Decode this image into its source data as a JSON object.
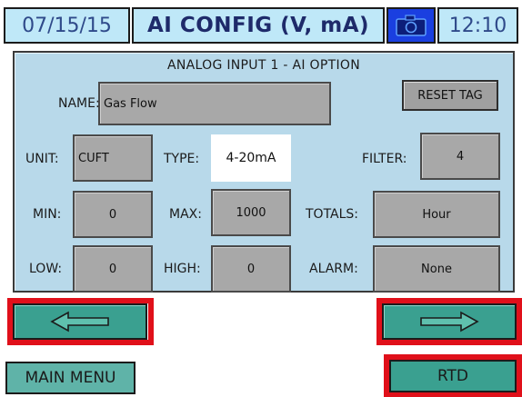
{
  "header": {
    "date": "07/15/15",
    "title": "AI CONFIG (V, mA)",
    "time": "12:10",
    "camera_icon": "camera-icon"
  },
  "panel": {
    "title": "ANALOG INPUT 1 - AI OPTION",
    "name_label": "NAME:",
    "name_value": "Gas Flow",
    "reset_label": "RESET TAG",
    "unit_label": "UNIT:",
    "unit_value": "CUFT",
    "type_label": "TYPE:",
    "type_value": "4-20mA",
    "filter_label": "FILTER:",
    "filter_value": "4",
    "min_label": "MIN:",
    "min_value": "0",
    "max_label": "MAX:",
    "max_value": "1000",
    "totals_label": "TOTALS:",
    "totals_value": "Hour",
    "low_label": "LOW:",
    "low_value": "0",
    "high_label": "HIGH:",
    "high_value": "0",
    "alarm_label": "ALARM:",
    "alarm_value": "None"
  },
  "nav": {
    "prev_icon": "arrow-left-icon",
    "next_icon": "arrow-right-icon",
    "main_menu_label": "MAIN MENU",
    "rtd_label": "RTD"
  },
  "colors": {
    "header_bg": "#bfe8f8",
    "panel_bg": "#b8d9ea",
    "field_bg": "#a8a8a8",
    "teal_button": "#3aa090",
    "highlight": "#e0101a",
    "camera_bg": "#1a3fe0"
  }
}
